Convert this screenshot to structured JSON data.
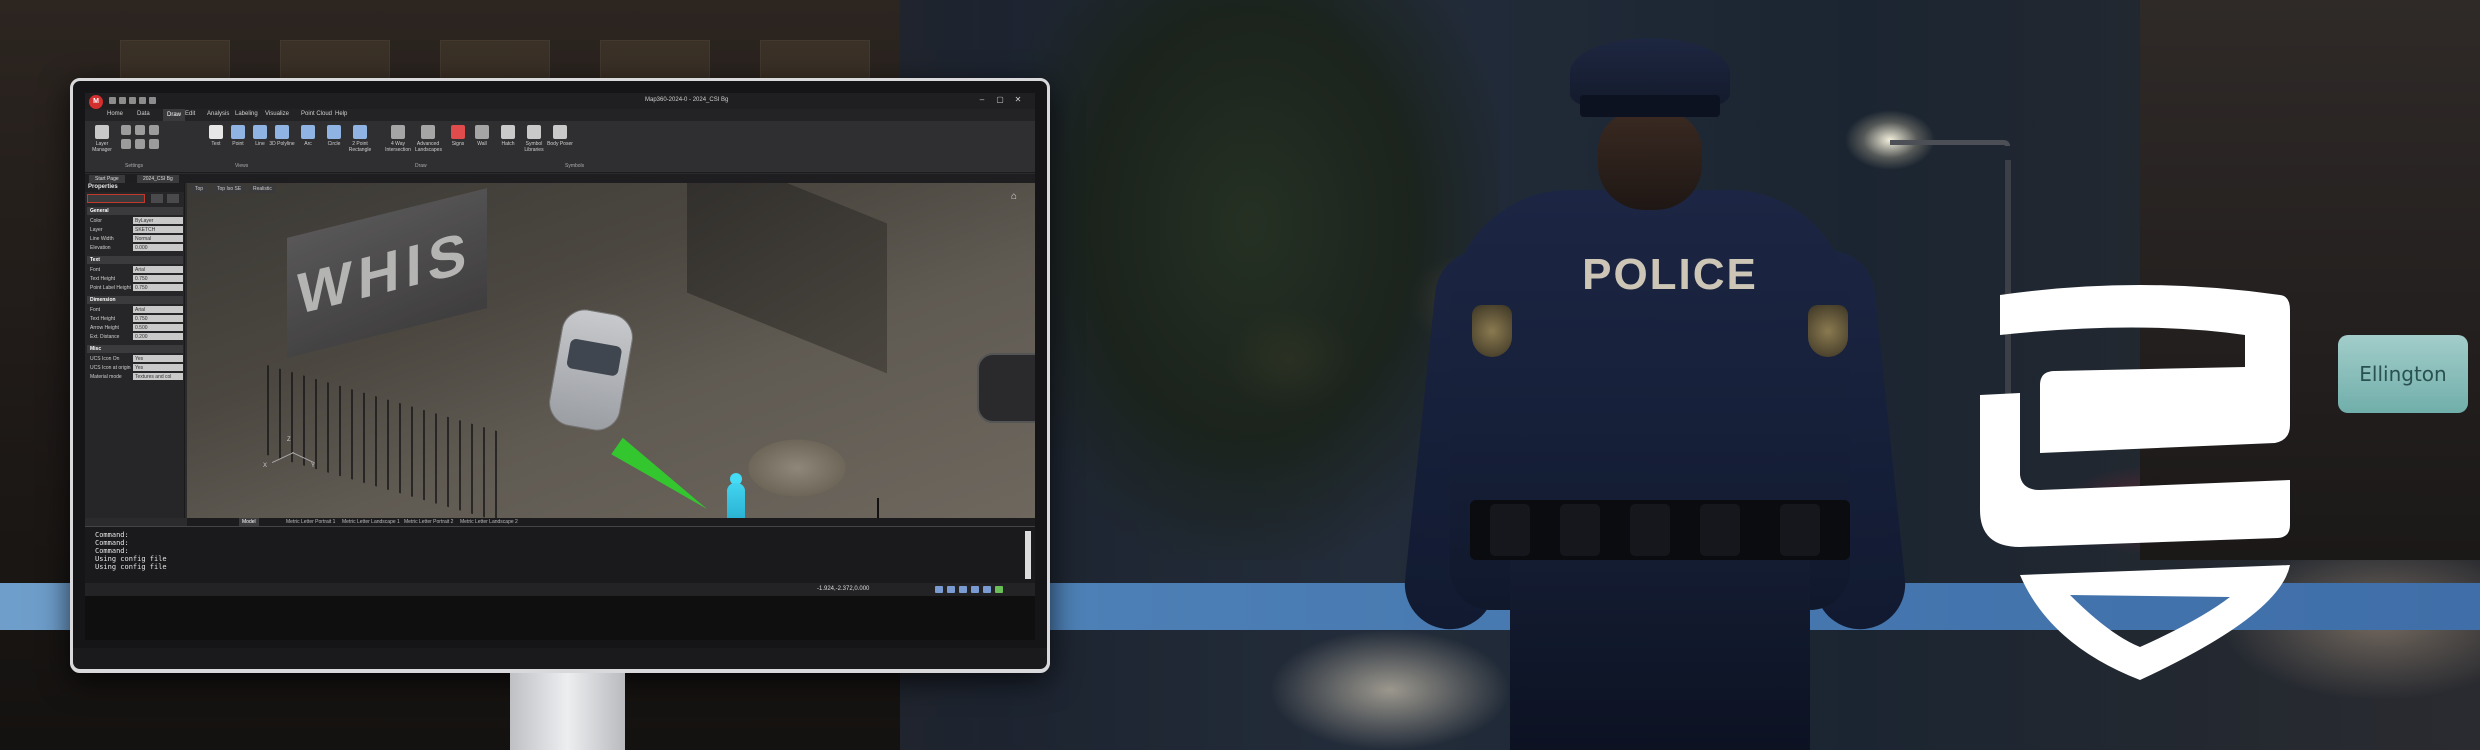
{
  "scene": {
    "officer_label": "POLICE",
    "street_sign": "Ellington"
  },
  "app": {
    "window_title": "Map360-2024-0 - 2024_CSI Bg",
    "menu": [
      "Home",
      "Data",
      "Draw",
      "Edit",
      "Analysis",
      "Labeling",
      "Visualize",
      "Point Cloud",
      "Help"
    ],
    "active_menu": "Draw",
    "ribbon_buttons": [
      {
        "label": "Layer Manager",
        "icon": "layers-icon",
        "color": "#c9c9c9"
      },
      {
        "label": "Text",
        "icon": "text-icon",
        "color": "#e7e7e7"
      },
      {
        "label": "Point",
        "icon": "point-icon",
        "color": "#8fb4e3"
      },
      {
        "label": "Line",
        "icon": "line-icon",
        "color": "#8fb4e3"
      },
      {
        "label": "3D Polyline",
        "icon": "polyline-icon",
        "color": "#8fb4e3"
      },
      {
        "label": "Arc",
        "icon": "arc-icon",
        "color": "#8fb4e3"
      },
      {
        "label": "Circle",
        "icon": "circle-icon",
        "color": "#8fb4e3"
      },
      {
        "label": "2 Point Rectangle",
        "icon": "rectangle-icon",
        "color": "#8fb4e3"
      },
      {
        "label": "4 Way Intersection",
        "icon": "intersection-icon",
        "color": "#a5a5a5"
      },
      {
        "label": "Advanced Landscapes",
        "icon": "landscape-icon",
        "color": "#a5a5a5"
      },
      {
        "label": "Signs",
        "icon": "sign-icon",
        "color": "#e04b4b"
      },
      {
        "label": "Wall",
        "icon": "wall-icon",
        "color": "#a5a5a5"
      },
      {
        "label": "Hatch",
        "icon": "hatch-icon",
        "color": "#c9c9c9"
      },
      {
        "label": "Symbol Libraries",
        "icon": "symbol-icon",
        "color": "#c9c9c9"
      },
      {
        "label": "Body Poser",
        "icon": "body-poser-icon",
        "color": "#c9c9c9"
      }
    ],
    "ribbon_groups": [
      "Settings",
      "Views",
      "Draw",
      "Symbols"
    ],
    "doc_tabs": [
      "Start Page",
      "2024_CSI Bg"
    ],
    "viewport_tabs": [
      "Top",
      "Top Iso SE",
      "Realistic"
    ],
    "wall_text": "WHIS",
    "properties": {
      "title": "Properties",
      "sections": [
        {
          "name": "General",
          "rows": [
            {
              "k": "Color",
              "v": "ByLayer"
            },
            {
              "k": "Layer",
              "v": "SKETCH"
            },
            {
              "k": "Line Width",
              "v": "Normal"
            },
            {
              "k": "Elevation",
              "v": "0.000"
            }
          ]
        },
        {
          "name": "Text",
          "rows": [
            {
              "k": "Font",
              "v": "Arial"
            },
            {
              "k": "Text Height",
              "v": "0.750"
            },
            {
              "k": "Point Label Height",
              "v": "0.750"
            }
          ]
        },
        {
          "name": "Dimension",
          "rows": [
            {
              "k": "Font",
              "v": "Arial"
            },
            {
              "k": "Text Height",
              "v": "0.750"
            },
            {
              "k": "Arrow Height",
              "v": "0.500"
            },
            {
              "k": "Ext. Distance",
              "v": "0.200"
            }
          ]
        },
        {
          "name": "Misc",
          "rows": [
            {
              "k": "UCS Icon On",
              "v": "Yes"
            },
            {
              "k": "UCS Icon at origin",
              "v": "Yes"
            },
            {
              "k": "Material mode",
              "v": "Textures and col"
            }
          ]
        }
      ]
    },
    "layout_tabs": [
      "Model",
      "Metric Letter Portrait 1",
      "Metric Letter Landscape 1",
      "Metric Letter Portrait 2",
      "Metric Letter Landscape 2"
    ],
    "command_lines": [
      "Command:",
      "Command:",
      "Command:",
      "Using config file",
      "Using config file"
    ],
    "coordinates": "-1.924,-2.372,0.000",
    "axis_labels": {
      "x": "X",
      "y": "Y",
      "z": "Z"
    }
  },
  "colors": {
    "band": "#4c7fb5",
    "sightline": "#2fd12b",
    "figure": "#41d4f0",
    "app_logo": "#d32f2f"
  }
}
